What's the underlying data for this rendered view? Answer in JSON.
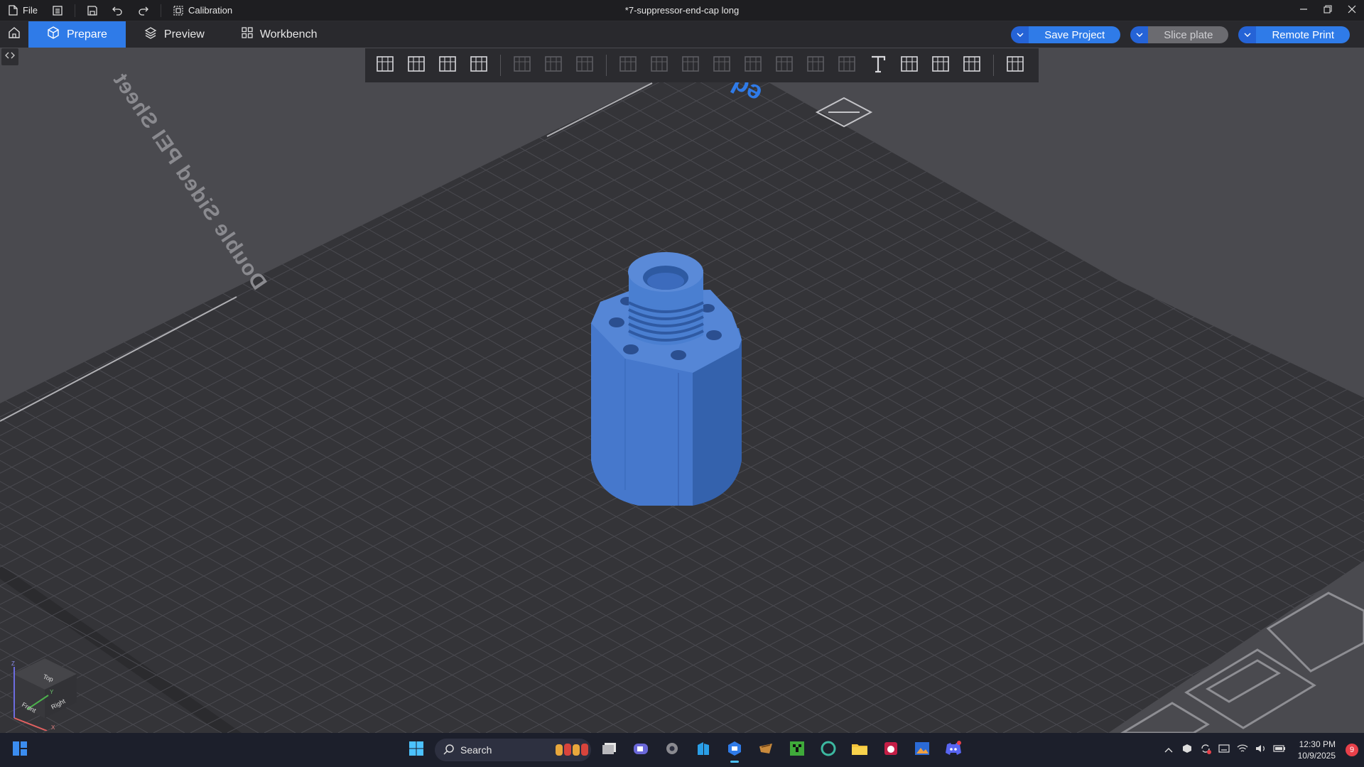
{
  "titlebar": {
    "file_label": "File",
    "calibration_label": "Calibration",
    "document_title": "*7-suppressor-end-cap long"
  },
  "tabs": [
    {
      "label": "Prepare",
      "icon": "cube-outline-icon",
      "active": true
    },
    {
      "label": "Preview",
      "icon": "layers-icon",
      "active": false
    },
    {
      "label": "Workbench",
      "icon": "grid-apps-icon",
      "active": false
    }
  ],
  "actions": {
    "save_project": "Save Project",
    "slice_plate": "Slice plate",
    "remote_print": "Remote Print"
  },
  "toolbar": {
    "tools": [
      "add-object-icon",
      "add-plate-icon",
      "auto-orient-icon",
      "arrange-icon",
      "split-objects-icon",
      "split-parts-icon",
      "layers-variable-icon",
      "move-icon",
      "rotate-icon",
      "scale-icon",
      "lay-on-face-icon",
      "cut-icon",
      "boolean-icon",
      "support-paint-icon",
      "seam-paint-icon",
      "text-icon",
      "mesh-boolean-icon",
      "measure-icon",
      "assembly-icon",
      "puzzle-icon"
    ]
  },
  "bed": {
    "label": "Double Sided PEI Sheet",
    "corner_text": "ed",
    "colors": {
      "plate": "#35353a",
      "grid": "#4a4a50",
      "model": "#3f73c7",
      "model_dark": "#3462ad",
      "accent": "#2f7be8"
    }
  },
  "view_cube": {
    "top": "Top",
    "front": "Front",
    "right": "Right",
    "axis_z": "Z",
    "axis_y": "Y",
    "axis_x": "X"
  },
  "taskbar": {
    "search_placeholder": "Search",
    "time": "12:30 PM",
    "date": "10/9/2025",
    "notification_count": "9"
  }
}
